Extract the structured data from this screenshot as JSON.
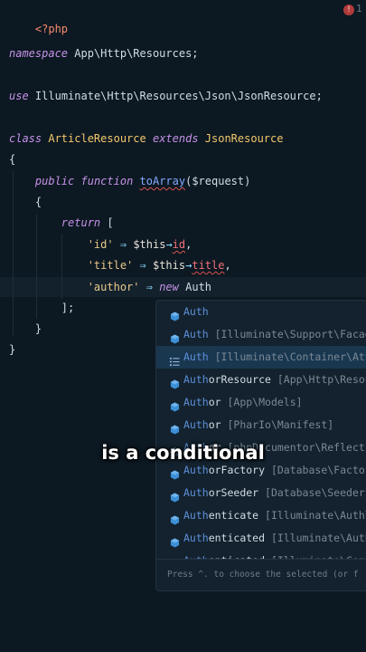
{
  "editor": {
    "lines": {
      "php_open": "<?php",
      "namespace_kw": "namespace",
      "namespace_val": "App\\Http\\Resources;",
      "use_kw": "use",
      "use_val": "Illuminate\\Http\\Resources\\Json\\JsonResource;",
      "class_kw": "class",
      "class_name": "ArticleResource",
      "extends_kw": "extends",
      "parent_class": "JsonResource",
      "open_brace": "{",
      "public_kw": "public",
      "function_kw": "function",
      "method_name": "toArray",
      "method_params": "($request)",
      "method_brace": "{",
      "return_kw": "return",
      "array_open": "[",
      "row1_key": "'id'",
      "row1_var": "$this",
      "row1_prop": "id",
      "row2_key": "'title'",
      "row2_var": "$this",
      "row2_prop": "title",
      "row3_key": "'author'",
      "new_kw": "new",
      "row3_typed": "Auth",
      "arrow": "⇒",
      "obj_arrow": "→",
      "comma": ",",
      "array_close": "];",
      "method_close": "}",
      "class_close": "}"
    },
    "problems_count": "1",
    "problems_icon": "error-icon"
  },
  "autocomplete": {
    "items": [
      {
        "match": "Auth",
        "rest": "",
        "qual": "",
        "icon": "class-icon"
      },
      {
        "match": "Auth",
        "rest": "",
        "qual": " [Illuminate\\Support\\Facad",
        "icon": "class-icon"
      },
      {
        "match": "Auth",
        "rest": "",
        "qual": " [Illuminate\\Container\\Att",
        "icon": "list-icon"
      },
      {
        "match": "Auth",
        "rest": "orResource",
        "qual": " [App\\Http\\Resou",
        "icon": "class-icon"
      },
      {
        "match": "Auth",
        "rest": "or",
        "qual": " [App\\Models]",
        "icon": "class-icon"
      },
      {
        "match": "Auth",
        "rest": "or",
        "qual": " [PharIo\\Manifest]",
        "icon": "class-icon"
      },
      {
        "match": "Auth",
        "rest": "or",
        "qual": " [phpDocumentor\\Reflecti",
        "icon": "gear-icon"
      },
      {
        "match": "Auth",
        "rest": "orFactory",
        "qual": " [Database\\Factor",
        "icon": "class-icon"
      },
      {
        "match": "Auth",
        "rest": "orSeeder",
        "qual": " [Database\\Seeders",
        "icon": "class-icon"
      },
      {
        "match": "Auth",
        "rest": "enticate",
        "qual": " [Illuminate\\Auth\\",
        "icon": "class-icon"
      },
      {
        "match": "Auth",
        "rest": "enticated",
        "qual": " [Illuminate\\Auth",
        "icon": "class-icon"
      },
      {
        "match": "Auth",
        "rest": "enticated",
        "qual": " [Illuminate\\Cont",
        "icon": "class-icon"
      }
    ],
    "selected_index": 2,
    "footer": "Press ^. to choose the selected (or f"
  },
  "caption": "is a conditional",
  "colors": {
    "background": "#0c1822",
    "keyword": "#c693e8",
    "class": "#f3c96b",
    "string": "#e8c88a",
    "match": "#5d8fd8",
    "selected": "#1a3750"
  }
}
